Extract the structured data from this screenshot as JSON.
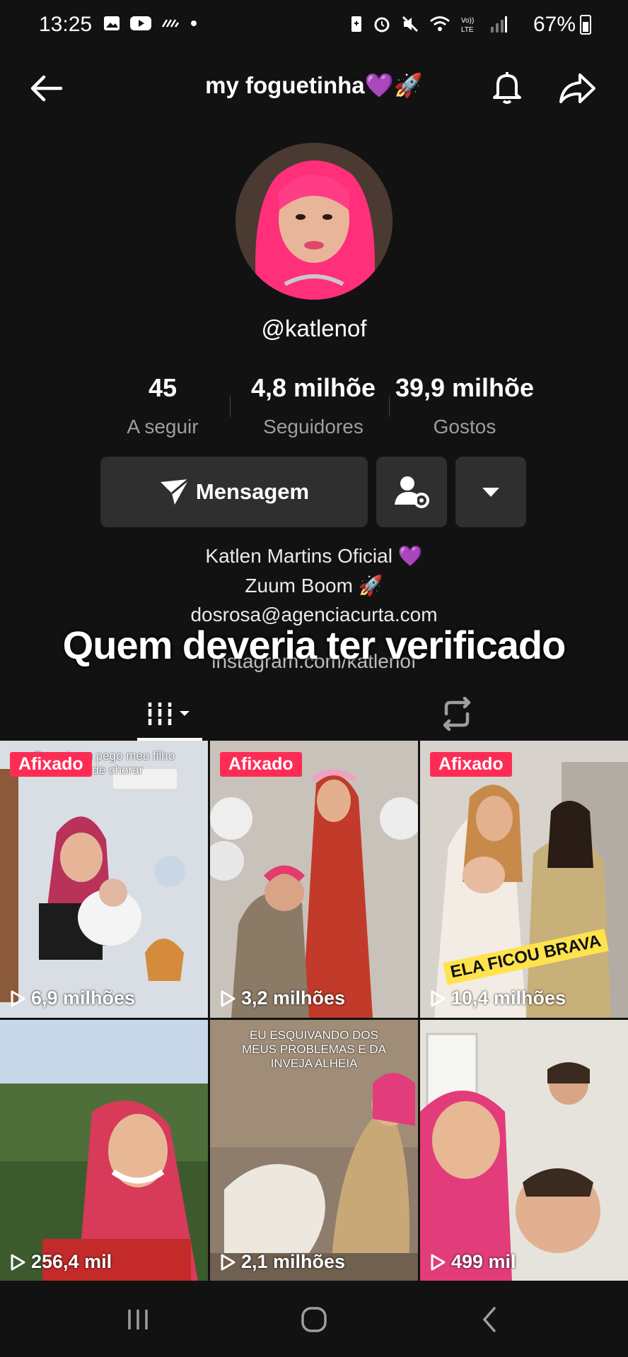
{
  "status_bar": {
    "time": "13:25",
    "battery": "67%"
  },
  "header": {
    "title": "my foguetinha💜🚀"
  },
  "profile": {
    "handle": "@katlenof",
    "stats": [
      {
        "value": "45",
        "label": "A seguir"
      },
      {
        "value": "4,8 milhõe",
        "label": "Seguidores"
      },
      {
        "value": "39,9 milhõe",
        "label": "Gostos"
      }
    ],
    "message_button": "Mensagem",
    "bio": [
      "Katlen Martins Oficial 💜",
      "Zuum Boom 🚀",
      "dosrosa@agenciacurta.com"
    ],
    "instagram_partial": "instagram.com/katlenof",
    "overlay_caption": "Quem deveria ter verificado"
  },
  "videos": [
    {
      "pinned": "Afixado",
      "views": "6,9 milhões",
      "caption": "Quando eu pego meu filho para de chorar"
    },
    {
      "pinned": "Afixado",
      "views": "3,2 milhões"
    },
    {
      "pinned": "Afixado",
      "views": "10,4 milhões",
      "sticker": "ELA FICOU BRAVA"
    },
    {
      "views": "256,4 mil"
    },
    {
      "views": "2,1 milhões",
      "caption": "EU ESQUIVANDO DOS MEUS PROBLEMAS E DA INVEJA ALHEIA"
    },
    {
      "views": "499 mil"
    }
  ],
  "icons": {
    "back": "arrow-left-icon",
    "bell": "bell-icon",
    "share": "share-icon",
    "message": "send-icon",
    "add_friend": "user-settings-icon",
    "more": "caret-down-icon",
    "grid_tab": "grid-icon",
    "repost_tab": "repost-icon",
    "play": "play-icon"
  },
  "colors": {
    "pin_badge": "#fe2c55",
    "background": "#121212",
    "button_bg": "#2f2f2f"
  }
}
